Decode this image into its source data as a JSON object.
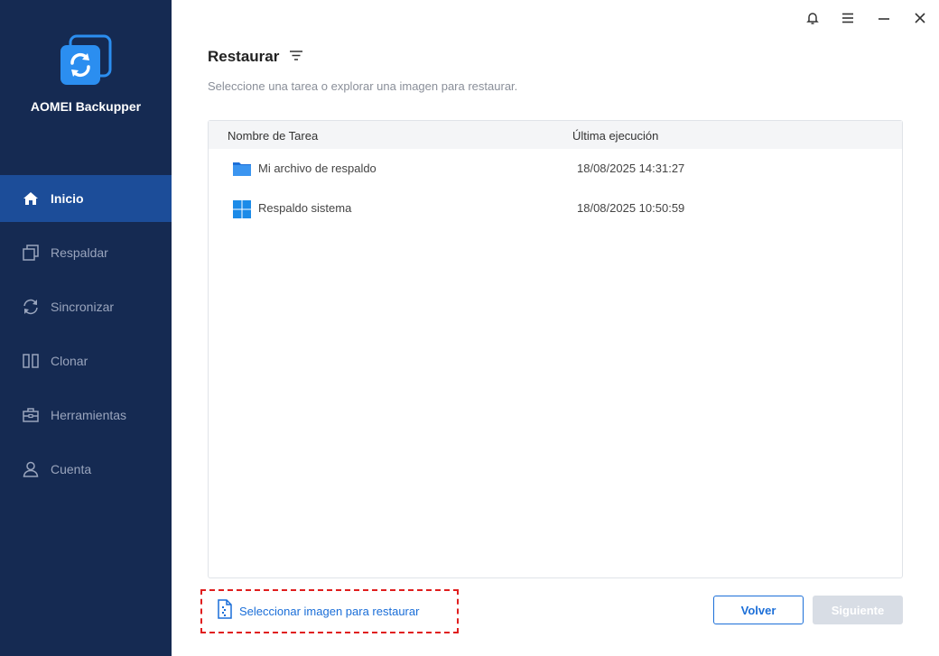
{
  "app": {
    "name": "AOMEI Backupper"
  },
  "sidebar": {
    "items": [
      {
        "label": "Inicio",
        "icon": "home-icon",
        "active": true
      },
      {
        "label": "Respaldar",
        "icon": "backup-icon",
        "active": false
      },
      {
        "label": "Sincronizar",
        "icon": "sync-icon",
        "active": false
      },
      {
        "label": "Clonar",
        "icon": "clone-icon",
        "active": false
      },
      {
        "label": "Herramientas",
        "icon": "toolbox-icon",
        "active": false
      },
      {
        "label": "Cuenta",
        "icon": "user-icon",
        "active": false
      }
    ]
  },
  "titlebar": {
    "icons": [
      "bell-icon",
      "menu-icon",
      "minimize-icon",
      "close-icon"
    ]
  },
  "main": {
    "title": "Restaurar",
    "subtitle": "Seleccione una tarea o explorar una imagen para restaurar.",
    "table": {
      "columns": [
        "Nombre de Tarea",
        "Última ejecución"
      ],
      "rows": [
        {
          "name": "Mi archivo de respaldo",
          "date": "18/08/2025 14:31:27",
          "icon": "folder-icon"
        },
        {
          "name": "Respaldo sistema",
          "date": "18/08/2025 10:50:59",
          "icon": "windows-icon"
        }
      ]
    },
    "select_image_label": "Seleccionar imagen para restaurar",
    "back_label": "Volver",
    "next_label": "Siguiente"
  },
  "colors": {
    "sidebar_bg": "#152a52",
    "sidebar_active": "#1c4d99",
    "accent": "#1c6fd8",
    "highlight_border": "#e01e1e"
  }
}
